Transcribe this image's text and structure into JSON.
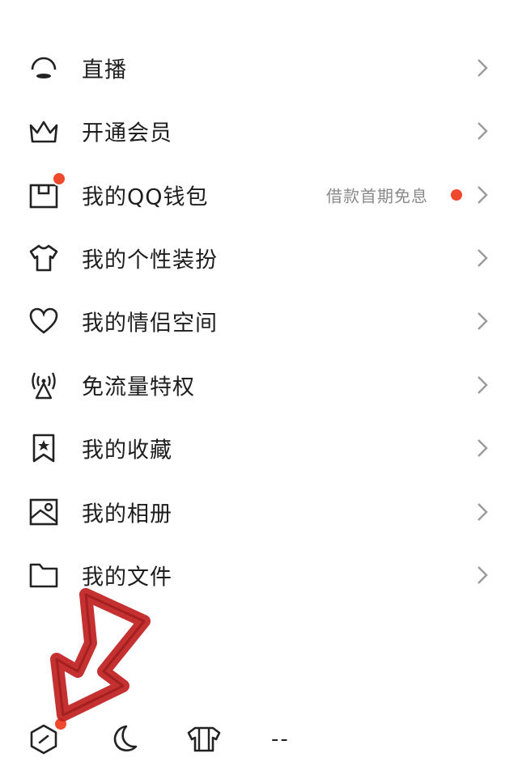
{
  "menu": {
    "items": [
      {
        "label": "直播",
        "icon": "live-icon"
      },
      {
        "label": "开通会员",
        "icon": "crown-icon"
      },
      {
        "label": "我的QQ钱包",
        "icon": "wallet-icon",
        "extra": "借款首期免息"
      },
      {
        "label": "我的个性装扮",
        "icon": "shirt-icon"
      },
      {
        "label": "我的情侣空间",
        "icon": "heart-icon"
      },
      {
        "label": "免流量特权",
        "icon": "signal-tower-icon"
      },
      {
        "label": "我的收藏",
        "icon": "bookmark-star-icon"
      },
      {
        "label": "我的相册",
        "icon": "photo-album-icon"
      },
      {
        "label": "我的文件",
        "icon": "folder-icon"
      }
    ]
  },
  "bottom_bar": {
    "items": [
      {
        "icon": "settings-hex-icon",
        "badge": true
      },
      {
        "icon": "moon-icon"
      },
      {
        "icon": "dress-up-icon"
      },
      {
        "icon": "dash-icon",
        "text": "--"
      }
    ]
  },
  "colors": {
    "badge": "#f04a2e",
    "annotation_arrow": "#c0201f"
  }
}
